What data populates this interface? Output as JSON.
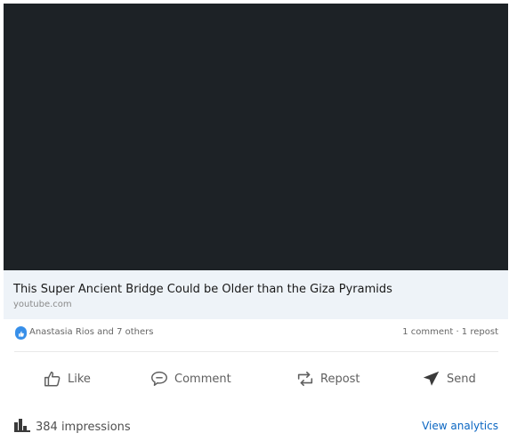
{
  "link_preview": {
    "title": "This Super Ancient Bridge Could be Older than the Giza Pyramids",
    "domain": "youtube.com"
  },
  "social": {
    "reactions_text": "Anastasia Rios and 7 others",
    "comments_reposts": "1 comment · 1 repost",
    "reaction_icon": "like-reaction-icon"
  },
  "actions": {
    "like": "Like",
    "comment": "Comment",
    "repost": "Repost",
    "send": "Send"
  },
  "footer": {
    "impressions": "384 impressions",
    "view_analytics": "View analytics"
  },
  "colors": {
    "video_background": "#1d2226",
    "preview_background": "#eef3f8",
    "link_blue": "#0a66c2",
    "reaction_blue": "#378fe9"
  }
}
